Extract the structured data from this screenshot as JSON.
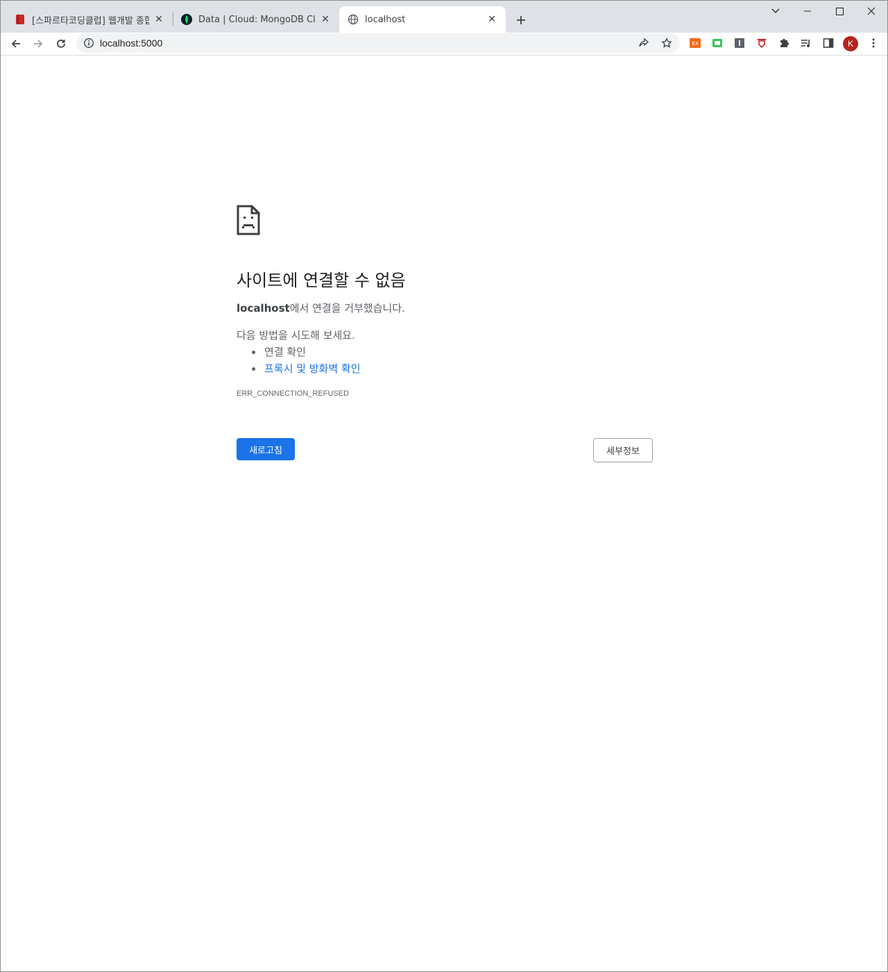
{
  "tabs": [
    {
      "title": "[스파르타코딩클럽] 웹개발 종합반",
      "favicon": "sparta-book-icon",
      "color": "#c62828"
    },
    {
      "title": "Data | Cloud: MongoDB Cloud",
      "favicon": "mongodb-leaf-icon",
      "color": "#00ed64"
    },
    {
      "title": "localhost",
      "favicon": "globe-icon",
      "active": true
    }
  ],
  "address_bar": {
    "url": "localhost:5000"
  },
  "profile": {
    "initial": "K",
    "color": "#b3261e"
  },
  "error_page": {
    "title": "사이트에 연결할 수 없음",
    "host": "localhost",
    "message_suffix": "에서 연결을 거부했습니다.",
    "try_heading": "다음 방법을 시도해 보세요.",
    "suggestions": [
      "연결 확인",
      "프록시 및 방화벽 확인"
    ],
    "error_code": "ERR_CONNECTION_REFUSED",
    "reload_button": "새로고침",
    "details_button": "세부정보"
  },
  "colors": {
    "accent": "#1a73e8",
    "text_secondary": "#5f6368"
  }
}
